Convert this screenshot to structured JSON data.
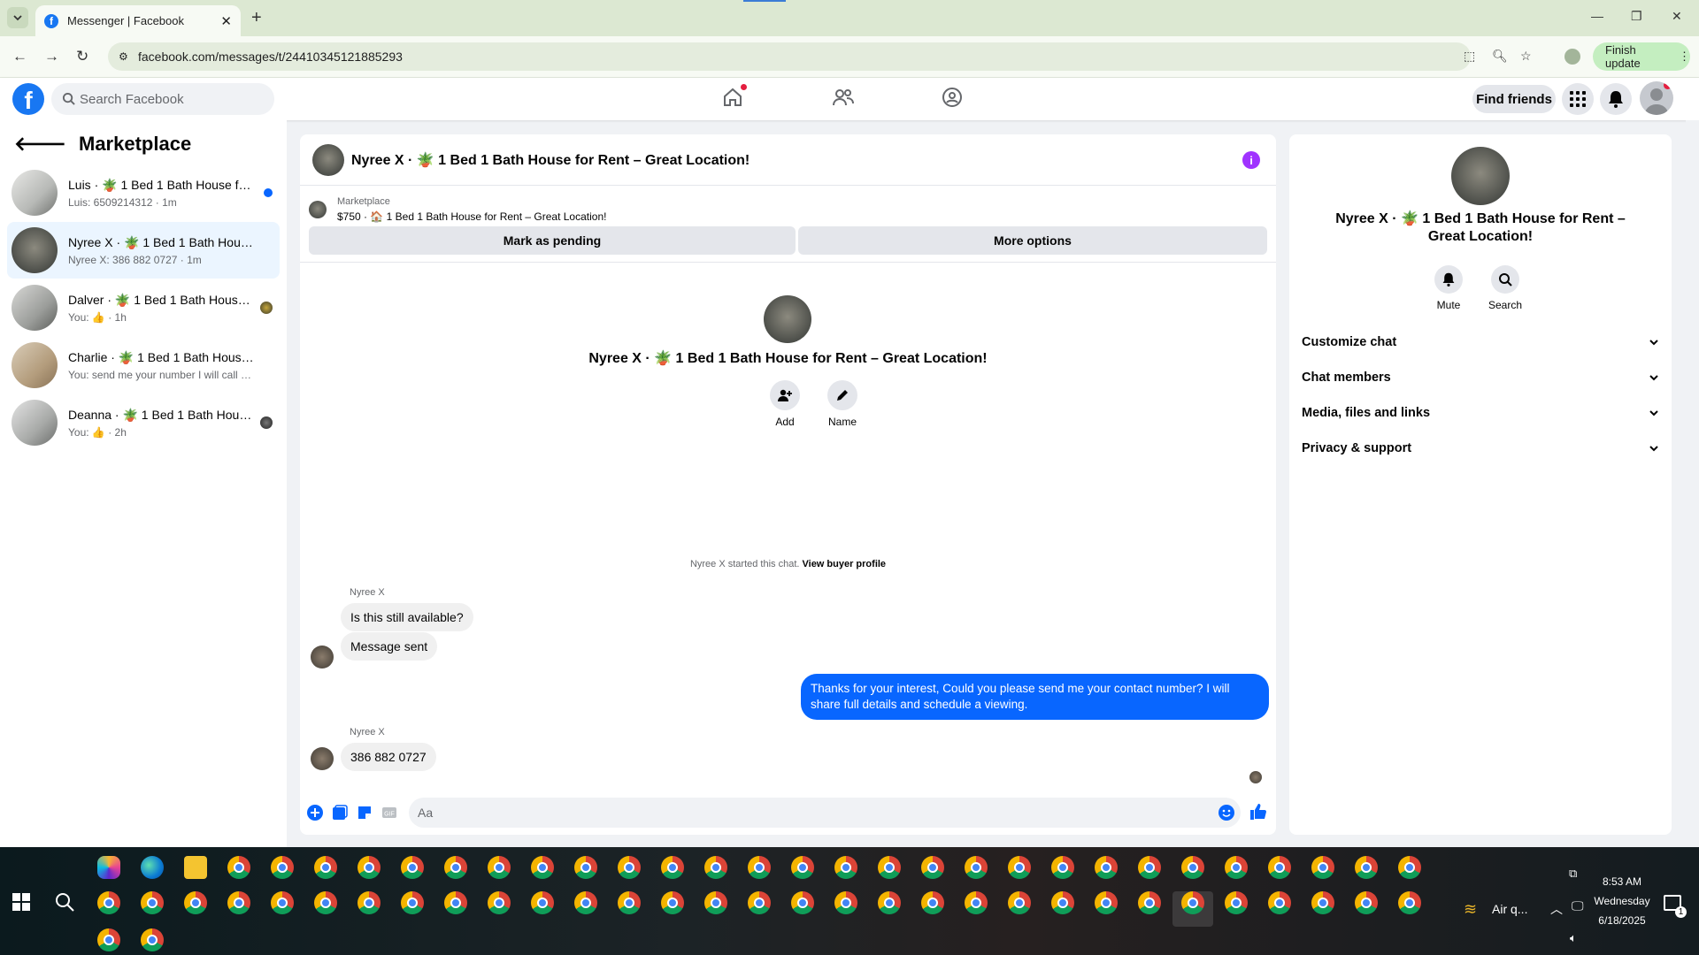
{
  "browser": {
    "tab_title": "Messenger | Facebook",
    "url": "facebook.com/messages/t/24410345121885293",
    "finish_update": "Finish update"
  },
  "facebook": {
    "search_placeholder": "Search Facebook",
    "find_friends": "Find friends"
  },
  "sidebar": {
    "title": "Marketplace",
    "conversations": [
      {
        "name": "Luis · 🪴 1 Bed 1 Bath House for ...",
        "preview": "Luis: 6509214312 · 1m",
        "indicator": "unread-dot"
      },
      {
        "name": "Nyree X · 🪴 1 Bed 1 Bath House fo...",
        "preview": "Nyree X: 386 882 0727 · 1m",
        "indicator": "none"
      },
      {
        "name": "Dalver · 🪴 1 Bed 1 Bath House f...",
        "preview": "You: 👍 · 1h",
        "indicator": "seen-avatar"
      },
      {
        "name": "Charlie · 🪴 1 Bed 1 Bath House for...",
        "preview": "You: send me your number I will call y... · 1h",
        "indicator": "none"
      },
      {
        "name": "Deanna · 🪴 1 Bed 1 Bath House ...",
        "preview": "You: 👍 · 2h",
        "indicator": "seen-avatar"
      }
    ]
  },
  "chat": {
    "header_title": "Nyree X · 🪴 1 Bed 1 Bath House for Rent – Great Location!",
    "marketplace_label": "Marketplace",
    "listing": "$750 · 🏠 1 Bed 1 Bath House for Rent – Great Location!",
    "mark_pending": "Mark as pending",
    "more_options": "More options",
    "center_title": "Nyree X · 🪴 1 Bed 1 Bath House for Rent – Great Location!",
    "add_label": "Add",
    "name_label": "Name",
    "started_text": "Nyree X started this chat.",
    "view_profile": "View buyer profile",
    "messages": [
      {
        "sender": "Nyree X",
        "text": "Is this still available?"
      },
      {
        "text": "Message sent"
      },
      {
        "from_me": true,
        "text": "Thanks for your interest, Could you please send me your contact number? I will share full details and schedule a viewing."
      },
      {
        "sender": "Nyree X",
        "text": "386 882 0727"
      }
    ],
    "composer_placeholder": "Aa"
  },
  "info_panel": {
    "title": "Nyree X · 🪴 1 Bed 1 Bath House for Rent – Great Location!",
    "mute": "Mute",
    "search": "Search",
    "sections": [
      "Customize chat",
      "Chat members",
      "Media, files and links",
      "Privacy & support"
    ]
  },
  "taskbar": {
    "weather": "Air q...",
    "time": "8:53 AM",
    "day": "Wednesday",
    "date": "6/18/2025",
    "notification_count": "1"
  },
  "colors": {
    "fb_blue": "#1877f2",
    "messenger_blue": "#0866ff",
    "info_purple": "#a033ff",
    "finish_update_bg": "#c4eec0"
  }
}
